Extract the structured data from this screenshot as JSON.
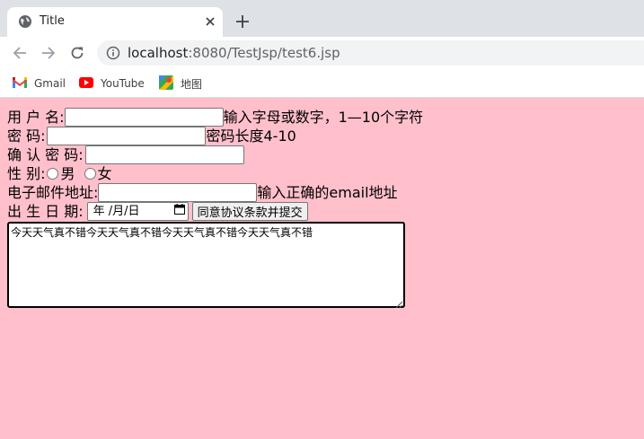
{
  "tab": {
    "title": "Title",
    "favicon": "globe-icon",
    "close_icon": "close-icon",
    "new_tab_icon": "plus-icon"
  },
  "toolbar": {
    "back_icon": "arrow-left-icon",
    "forward_icon": "arrow-right-icon",
    "reload_icon": "reload-icon",
    "info_icon": "info-icon",
    "url_host": "localhost",
    "url_rest": ":8080/TestJsp/test6.jsp"
  },
  "bookmarks": [
    {
      "label": "Gmail",
      "icon": "gmail-icon"
    },
    {
      "label": "YouTube",
      "icon": "youtube-icon"
    },
    {
      "label": "地图",
      "icon": "maps-icon"
    }
  ],
  "form": {
    "username_label": "用 户 名:",
    "username_value": "",
    "username_hint": "输入字母或数字，1—10个字符",
    "password_label": "密 码:",
    "password_value": "",
    "password_hint": "密码长度4-10",
    "confirm_label": "确 认 密 码:",
    "confirm_value": "",
    "gender_label": "性 别:",
    "gender_male": "男",
    "gender_female": "女",
    "email_label": "电子邮件地址:",
    "email_value": "",
    "email_hint": "输入正确的email地址",
    "birthday_label": "出 生 日 期:",
    "birthday_placeholder": "年 /月/日",
    "submit_label": "同意协议条款并提交",
    "agreement_text": "今天天气真不错今天天气真不错今天天气真不错今天天气真不错"
  },
  "colors": {
    "page_background": "#ffc0cb",
    "tabstrip_background": "#dee1e6",
    "omnibox_background": "#f1f3f4"
  }
}
